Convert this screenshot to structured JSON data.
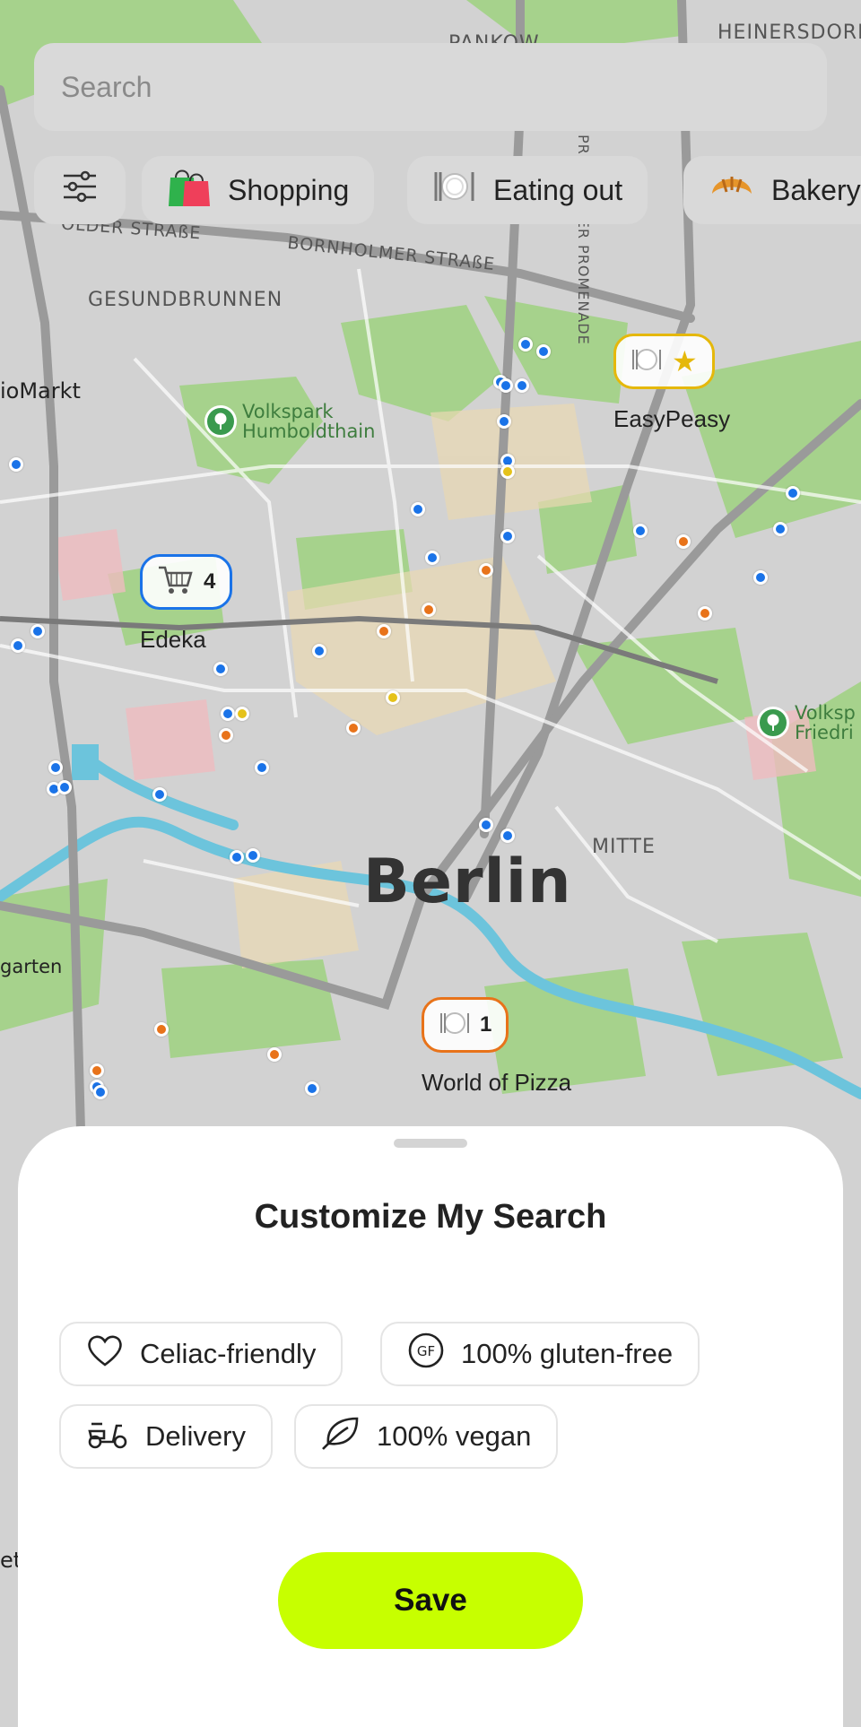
{
  "search": {
    "placeholder": "Search"
  },
  "categories": [
    {
      "label": "Shopping",
      "icon": "shopping-bag-icon"
    },
    {
      "label": "Eating out",
      "icon": "fork-knife-icon"
    },
    {
      "label": "Bakery",
      "icon": "croissant-icon"
    }
  ],
  "filter_button": {
    "icon": "sliders-icon"
  },
  "map": {
    "labels": {
      "heinersdorf": "HEINERSDORF",
      "pankow": "PANKOW",
      "gesundbrunnen": "GESUNDBRUNNEN",
      "bornholmer": "BORNHOLMER STRAßE",
      "wolder": "OLDER STRAßE",
      "prenzlauer": "PRENZLAUER PROMENADE",
      "mitte": "MITTE",
      "city": "Berlin",
      "biomarkt": "ioMarkt",
      "garten": "garten",
      "et": "et",
      "volkspark_humboldthain_1": "Volkspark",
      "volkspark_humboldthain_2": "Humboldthain",
      "volkspark_friedrichshain_1": "Volksp",
      "volkspark_friedrichshain_2": "Friedri"
    },
    "pins": {
      "easypeasy": {
        "label": "EasyPeasy",
        "icon": "fork-knife-icon",
        "badge": "star-icon",
        "color": "#e5b80b"
      },
      "edeka": {
        "label": "Edeka",
        "icon": "shopping-cart-icon",
        "count": "4",
        "color": "#1a73e8"
      },
      "world_of_pizza": {
        "label": "World of Pizza",
        "icon": "fork-knife-icon",
        "count": "1",
        "color": "#e8731a"
      }
    },
    "colors": {
      "blue": "#1a73e8",
      "orange": "#e8731a",
      "yellow": "#e5c21a",
      "park": "#a8d48f",
      "road": "#8e8e8e"
    }
  },
  "sheet": {
    "title": "Customize My Search",
    "options": [
      {
        "label": "Celiac-friendly",
        "icon": "heart-icon"
      },
      {
        "label": "100% gluten-free",
        "icon": "gf-icon"
      },
      {
        "label": "Delivery",
        "icon": "scooter-icon"
      },
      {
        "label": "100% vegan",
        "icon": "leaf-icon"
      }
    ],
    "save_label": "Save"
  }
}
